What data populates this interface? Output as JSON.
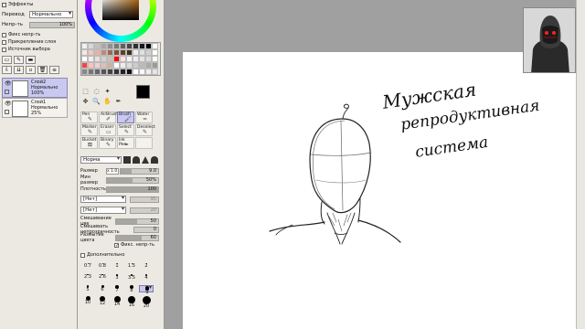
{
  "layers_panel": {
    "title": "Эффекты",
    "mode_label": "Перевод",
    "mode_value": "Нормально",
    "opacity_label": "Непр-ть",
    "opacity_value": "100%",
    "checkbox1": "Фикс непр-ть",
    "checkbox2": "Прикрепление слоя",
    "checkbox3": "Источник выбора",
    "layers": [
      {
        "name": "Слой2",
        "mode": "Нормально",
        "opacity": "100%"
      },
      {
        "name": "Слой1",
        "mode": "Нормально",
        "opacity": "25%"
      }
    ]
  },
  "tool_panel": {
    "brushes": [
      "Pen",
      "AirBrush",
      "Brush",
      "Water",
      "Marker",
      "Eraser",
      "Select",
      "Deselect",
      "Bucket",
      "Binary",
      "Ink Pen",
      ""
    ],
    "active_brush": "Brush",
    "mode_value": "Норма",
    "params": {
      "size_label": "Размер",
      "size_mult": "x 1.0",
      "size_value": "9.0",
      "min_size_label": "Мин размер",
      "min_size_value": "50%",
      "density_label": "Плотность",
      "density_value": "100",
      "texture1_value": "[Нет]",
      "texture1_strength": "95",
      "texture2_value": "[Нет]",
      "texture2_strength": "20",
      "mix_label": "Смешивание цве",
      "mix_value": "50",
      "dilute_label": "Смешивать непрозрачность",
      "dilute_value": "0",
      "blur_label": "Размытие цвета",
      "blur_value": "60",
      "fix_label": "Фикс. непр-ть",
      "advanced_label": "Дополнительно"
    },
    "sizes": [
      "0.7",
      "0.8",
      "1",
      "1.5",
      "2",
      "2.3",
      "2.6",
      "3",
      "3.5",
      "4",
      "5",
      "6",
      "7",
      "8",
      "9",
      "10",
      "12",
      "14",
      "16",
      "20"
    ],
    "selected_size": "9"
  },
  "canvas": {
    "caption_line1": "Мужская",
    "caption_line2": "репродуктивная",
    "caption_line3": "система"
  },
  "colors": {
    "panel_bg": "#ece9e2",
    "selection": "#c8c8f0",
    "paper": "#ffffff",
    "canvas_bg": "#a0a0a0"
  }
}
